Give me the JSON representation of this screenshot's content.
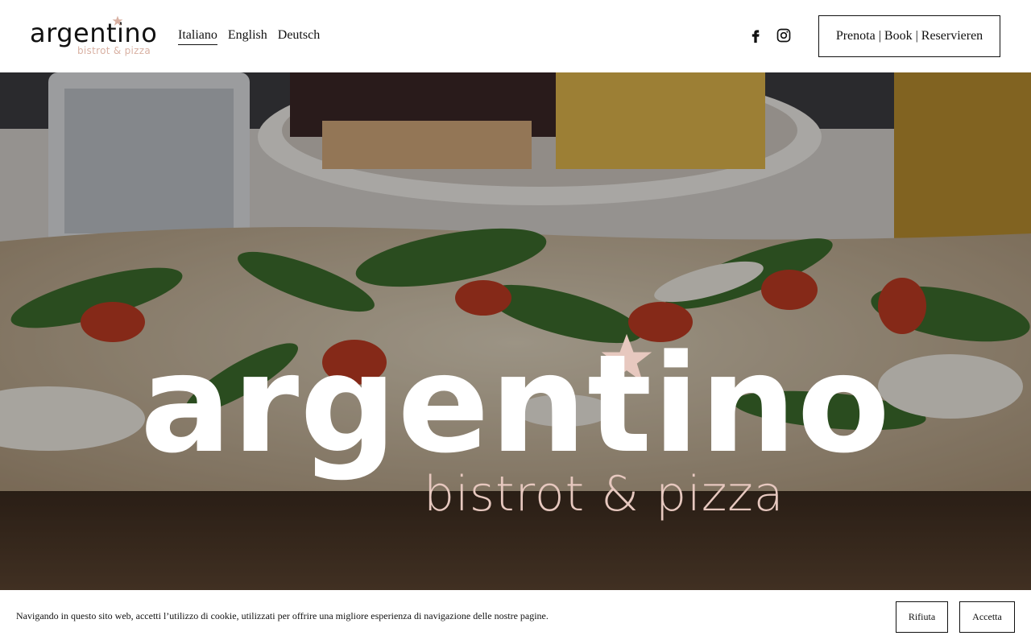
{
  "header": {
    "logo": {
      "word": "argentino",
      "sub": "bistrot & pizza"
    },
    "languages": [
      {
        "label": "Italiano",
        "active": true
      },
      {
        "label": "English",
        "active": false
      },
      {
        "label": "Deutsch",
        "active": false
      }
    ],
    "social": {
      "facebook": "facebook-icon",
      "instagram": "instagram-icon"
    },
    "book_button": "Prenota | Book | Reservieren"
  },
  "hero": {
    "title": "argentino",
    "subtitle": "bistrot & pizza",
    "accent_color": "#e7c8bf"
  },
  "cookie": {
    "text": "Navigando in questo sito web, accetti l’utilizzo di cookie, utilizzati per offrire una migliore esperienza di navigazione delle nostre pagine.",
    "reject": "Rifiuta",
    "accept": "Accetta"
  }
}
